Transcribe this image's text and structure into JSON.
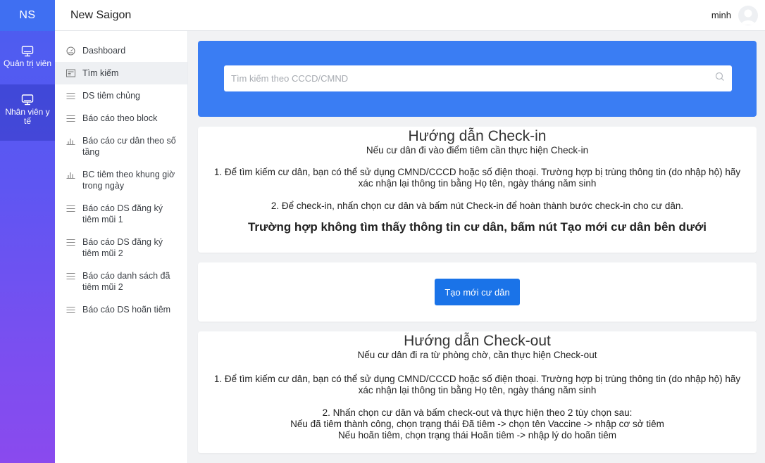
{
  "rail": {
    "logo": "NS",
    "items": [
      {
        "label": "Quản trị viên",
        "icon": "monitor-icon"
      },
      {
        "label": "Nhân viên y tế",
        "icon": "monitor-icon"
      }
    ]
  },
  "header": {
    "title": "New Saigon",
    "username": "minh"
  },
  "sidebar": {
    "items": [
      {
        "label": "Dashboard",
        "icon": "dashboard-icon"
      },
      {
        "label": "Tìm kiếm",
        "icon": "search-card-icon"
      },
      {
        "label": "DS tiêm chủng",
        "icon": "list-icon"
      },
      {
        "label": "Báo cáo theo block",
        "icon": "list-icon"
      },
      {
        "label": "Báo cáo cư dân theo số tầng",
        "icon": "bar-chart-icon"
      },
      {
        "label": "BC tiêm theo khung giờ trong ngày",
        "icon": "bar-chart-icon"
      },
      {
        "label": "Báo cáo DS đăng ký tiêm mũi 1",
        "icon": "list-icon"
      },
      {
        "label": "Báo cáo DS đăng ký tiêm mũi 2",
        "icon": "list-icon"
      },
      {
        "label": "Báo cáo danh sách đã tiêm mũi 2",
        "icon": "list-icon"
      },
      {
        "label": "Báo cáo DS hoãn tiêm",
        "icon": "list-icon"
      }
    ]
  },
  "search": {
    "placeholder": "Tìm kiếm theo CCCD/CMND"
  },
  "checkin": {
    "title": "Hướng dẫn Check-in",
    "subtitle": "Nếu cư dân đi vào điểm tiêm cần thực hiện Check-in",
    "step1": "1. Để tìm kiếm cư dân, bạn có thể sử dụng CMND/CCCD hoặc số điện thoại. Trường hợp bị trùng thông tin (do nhập hộ) hãy xác nhận lại thông tin bằng Họ tên, ngày tháng năm sinh",
    "step2": "2. Để check-in, nhấn chọn cư dân và bấm nút Check-in để hoàn thành bước check-in cho cư dân.",
    "note": "Trường hợp không tìm thấy thông tin cư dân, bấm nút Tạo mới cư dân bên dưới"
  },
  "actions": {
    "create_label": "Tạo mới cư dân"
  },
  "checkout": {
    "title": "Hướng dẫn Check-out",
    "subtitle": "Nếu cư dân đi ra từ phòng chờ, cần thực hiện Check-out",
    "step1": "1. Để tìm kiếm cư dân, bạn có thể sử dụng CMND/CCCD hoặc số điện thoại. Trường hợp bị trùng thông tin (do nhập hộ) hãy xác nhận lại thông tin bằng Họ tên, ngày tháng năm sinh",
    "step2_lines": [
      "2. Nhấn chọn cư dân và bấm check-out và thực hiện theo 2 tùy chọn sau:",
      "Nếu đã tiêm thành công, chọn trạng thái Đã tiêm -> chọn tên Vaccine -> nhập cơ sở tiêm",
      "Nếu hoãn tiêm, chọn trạng thái Hoãn tiêm -> nhập lý do hoãn tiêm"
    ]
  },
  "colors": {
    "rail_top": "#4a5ef0",
    "rail_bottom": "#8a4aee",
    "accent": "#3a7df3",
    "button": "#1a73e8"
  }
}
